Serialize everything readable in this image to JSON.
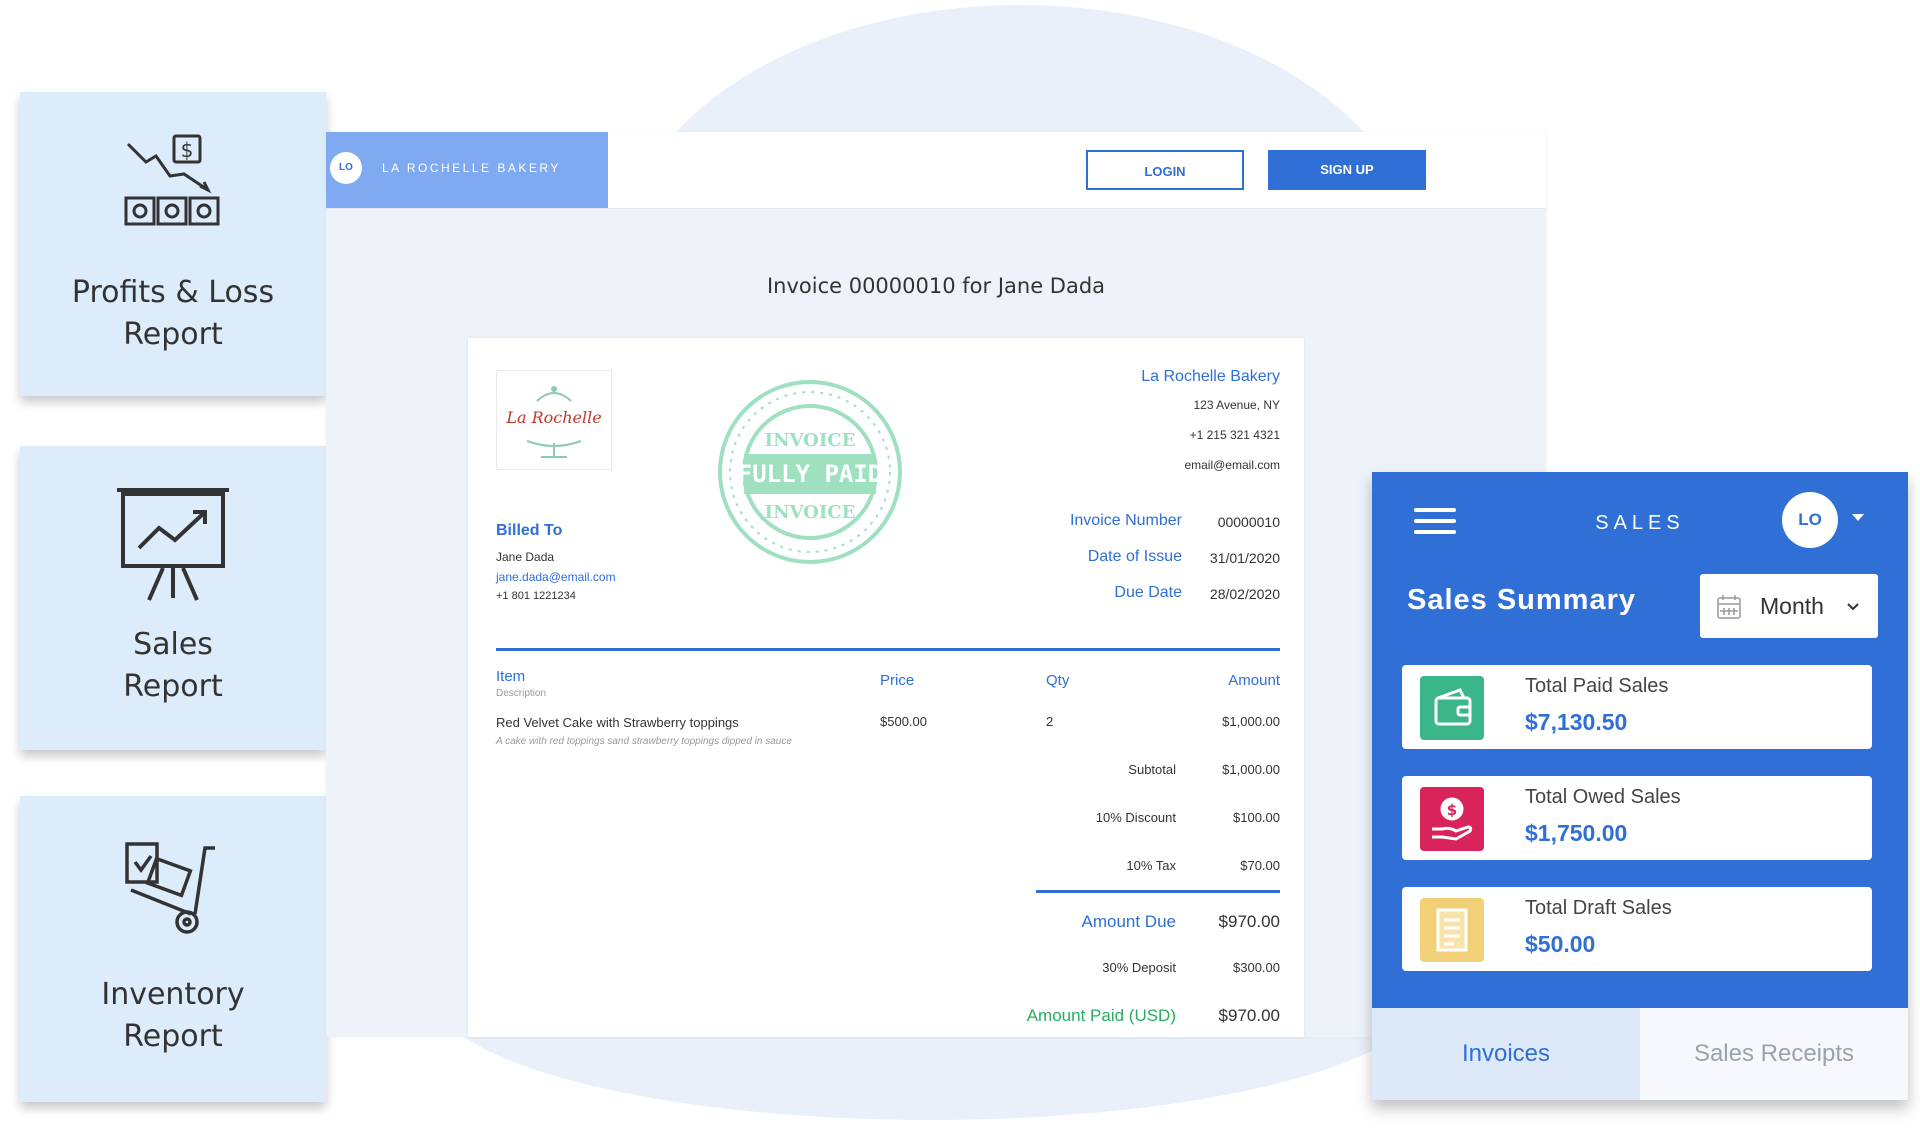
{
  "reports": [
    {
      "line1": "Profits & Loss",
      "line2": "Report",
      "icon": "profit-loss-icon"
    },
    {
      "line1": "Sales",
      "line2": "Report",
      "icon": "presentation-chart-icon"
    },
    {
      "line1": "Inventory",
      "line2": "Report",
      "icon": "hand-truck-icon"
    }
  ],
  "header": {
    "avatar": "LO",
    "brand": "LA ROCHELLE BAKERY",
    "login": "LOGIN",
    "signup": "SIGN UP"
  },
  "invoice": {
    "title": "Invoice 00000010 for Jane Dada",
    "logo_text": "La Rochelle",
    "business": {
      "name": "La Rochelle Bakery",
      "address": "123 Avenue, NY",
      "phone": "+1 215 321 4321",
      "email": "email@email.com"
    },
    "stamp": {
      "top": "INVOICE",
      "middle": "FULLY PAID",
      "bottom": "INVOICE"
    },
    "billed_to": {
      "label": "Billed To",
      "name": "Jane Dada",
      "email": "jane.dada@email.com",
      "phone": "+1 801 1221234"
    },
    "meta": {
      "number_label": "Invoice Number",
      "number": "00000010",
      "issue_label": "Date of Issue",
      "issue": "31/01/2020",
      "due_label": "Due Date",
      "due": "28/02/2020"
    },
    "columns": {
      "item": "Item",
      "description": "Description",
      "price": "Price",
      "qty": "Qty",
      "amount": "Amount"
    },
    "items": [
      {
        "name": "Red Velvet Cake with Strawberry toppings",
        "description": "A cake with red toppings sand strawberry toppings dipped in sauce",
        "price": "$500.00",
        "qty": "2",
        "amount": "$1,000.00"
      }
    ],
    "totals": {
      "subtotal_label": "Subtotal",
      "subtotal": "$1,000.00",
      "discount_label": "10% Discount",
      "discount": "$100.00",
      "tax_label": "10% Tax",
      "tax": "$70.00",
      "due_label": "Amount Due",
      "due": "$970.00",
      "deposit_label": "30% Deposit",
      "deposit": "$300.00",
      "paid_label": "Amount Paid (USD)",
      "paid": "$970.00"
    }
  },
  "sales": {
    "title": "SALES",
    "avatar": "LO",
    "summary": "Sales Summary",
    "period": "Month",
    "cards": [
      {
        "label": "Total Paid Sales",
        "value": "$7,130.50",
        "color": "#3bb58a",
        "icon": "wallet-icon"
      },
      {
        "label": "Total Owed Sales",
        "value": "$1,750.00",
        "color": "#d8245a",
        "icon": "hand-dollar-icon"
      },
      {
        "label": "Total Draft Sales",
        "value": "$50.00",
        "color": "#f2d078",
        "icon": "receipt-icon"
      }
    ],
    "tabs": [
      "Invoices",
      "Sales Receipts"
    ]
  }
}
